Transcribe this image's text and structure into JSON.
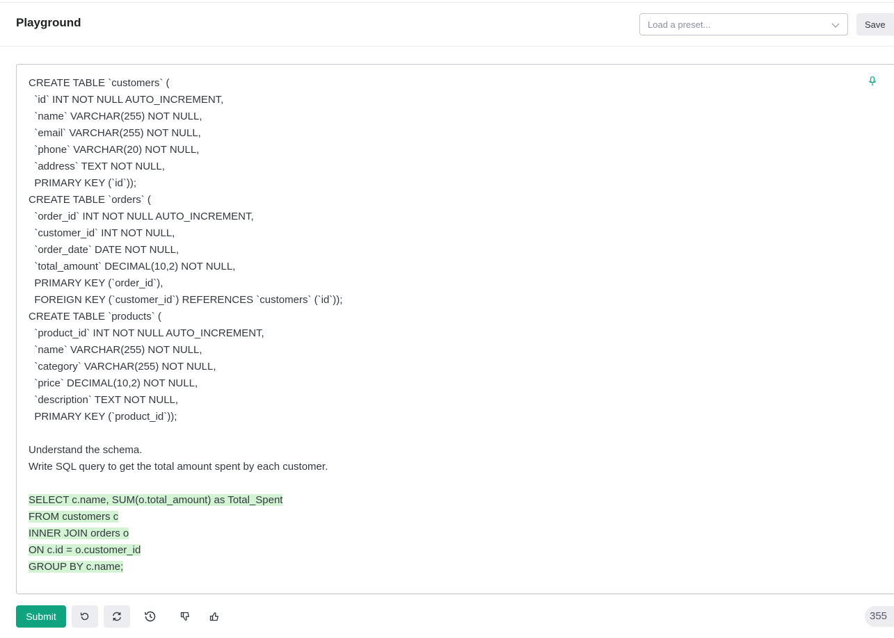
{
  "header": {
    "title": "Playground",
    "preset_placeholder": "Load a preset...",
    "save_label": "Save"
  },
  "editor": {
    "lines": [
      {
        "text": "CREATE TABLE `customers` (",
        "highlight": false
      },
      {
        "text": "  `id` INT NOT NULL AUTO_INCREMENT,",
        "highlight": false
      },
      {
        "text": "  `name` VARCHAR(255) NOT NULL,",
        "highlight": false
      },
      {
        "text": "  `email` VARCHAR(255) NOT NULL,",
        "highlight": false
      },
      {
        "text": "  `phone` VARCHAR(20) NOT NULL,",
        "highlight": false
      },
      {
        "text": "  `address` TEXT NOT NULL,",
        "highlight": false
      },
      {
        "text": "  PRIMARY KEY (`id`));",
        "highlight": false
      },
      {
        "text": "CREATE TABLE `orders` (",
        "highlight": false
      },
      {
        "text": "  `order_id` INT NOT NULL AUTO_INCREMENT,",
        "highlight": false
      },
      {
        "text": "  `customer_id` INT NOT NULL,",
        "highlight": false
      },
      {
        "text": "  `order_date` DATE NOT NULL,",
        "highlight": false
      },
      {
        "text": "  `total_amount` DECIMAL(10,2) NOT NULL,",
        "highlight": false
      },
      {
        "text": "  PRIMARY KEY (`order_id`),",
        "highlight": false
      },
      {
        "text": "  FOREIGN KEY (`customer_id`) REFERENCES `customers` (`id`));",
        "highlight": false
      },
      {
        "text": "CREATE TABLE `products` (",
        "highlight": false
      },
      {
        "text": "  `product_id` INT NOT NULL AUTO_INCREMENT,",
        "highlight": false
      },
      {
        "text": "  `name` VARCHAR(255) NOT NULL,",
        "highlight": false
      },
      {
        "text": "  `category` VARCHAR(255) NOT NULL,",
        "highlight": false
      },
      {
        "text": "  `price` DECIMAL(10,2) NOT NULL,",
        "highlight": false
      },
      {
        "text": "  `description` TEXT NOT NULL,",
        "highlight": false
      },
      {
        "text": "  PRIMARY KEY (`product_id`));",
        "highlight": false
      },
      {
        "text": "",
        "highlight": false
      },
      {
        "text": "Understand the schema.",
        "highlight": false
      },
      {
        "text": "Write SQL query to get the total amount spent by each customer.",
        "highlight": false
      },
      {
        "text": "",
        "highlight": false
      },
      {
        "text": "SELECT c.name, SUM(o.total_amount) as Total_Spent",
        "highlight": true
      },
      {
        "text": "FROM customers c",
        "highlight": true
      },
      {
        "text": "INNER JOIN orders o",
        "highlight": true
      },
      {
        "text": "ON c.id = o.customer_id",
        "highlight": true
      },
      {
        "text": "GROUP BY c.name;",
        "highlight": true
      }
    ]
  },
  "footer": {
    "submit_label": "Submit",
    "token_count": "355"
  },
  "icons": {
    "mic": "microphone-icon",
    "undo": "undo-icon",
    "regenerate": "regenerate-icon",
    "history": "history-icon",
    "dislike": "thumbs-down-icon",
    "like": "thumbs-up-icon",
    "preset_dropdown": "chevron-down-icon"
  },
  "colors": {
    "accent": "#10a37f",
    "highlight": "#d2f4d3",
    "button_bg": "#ececf1"
  }
}
